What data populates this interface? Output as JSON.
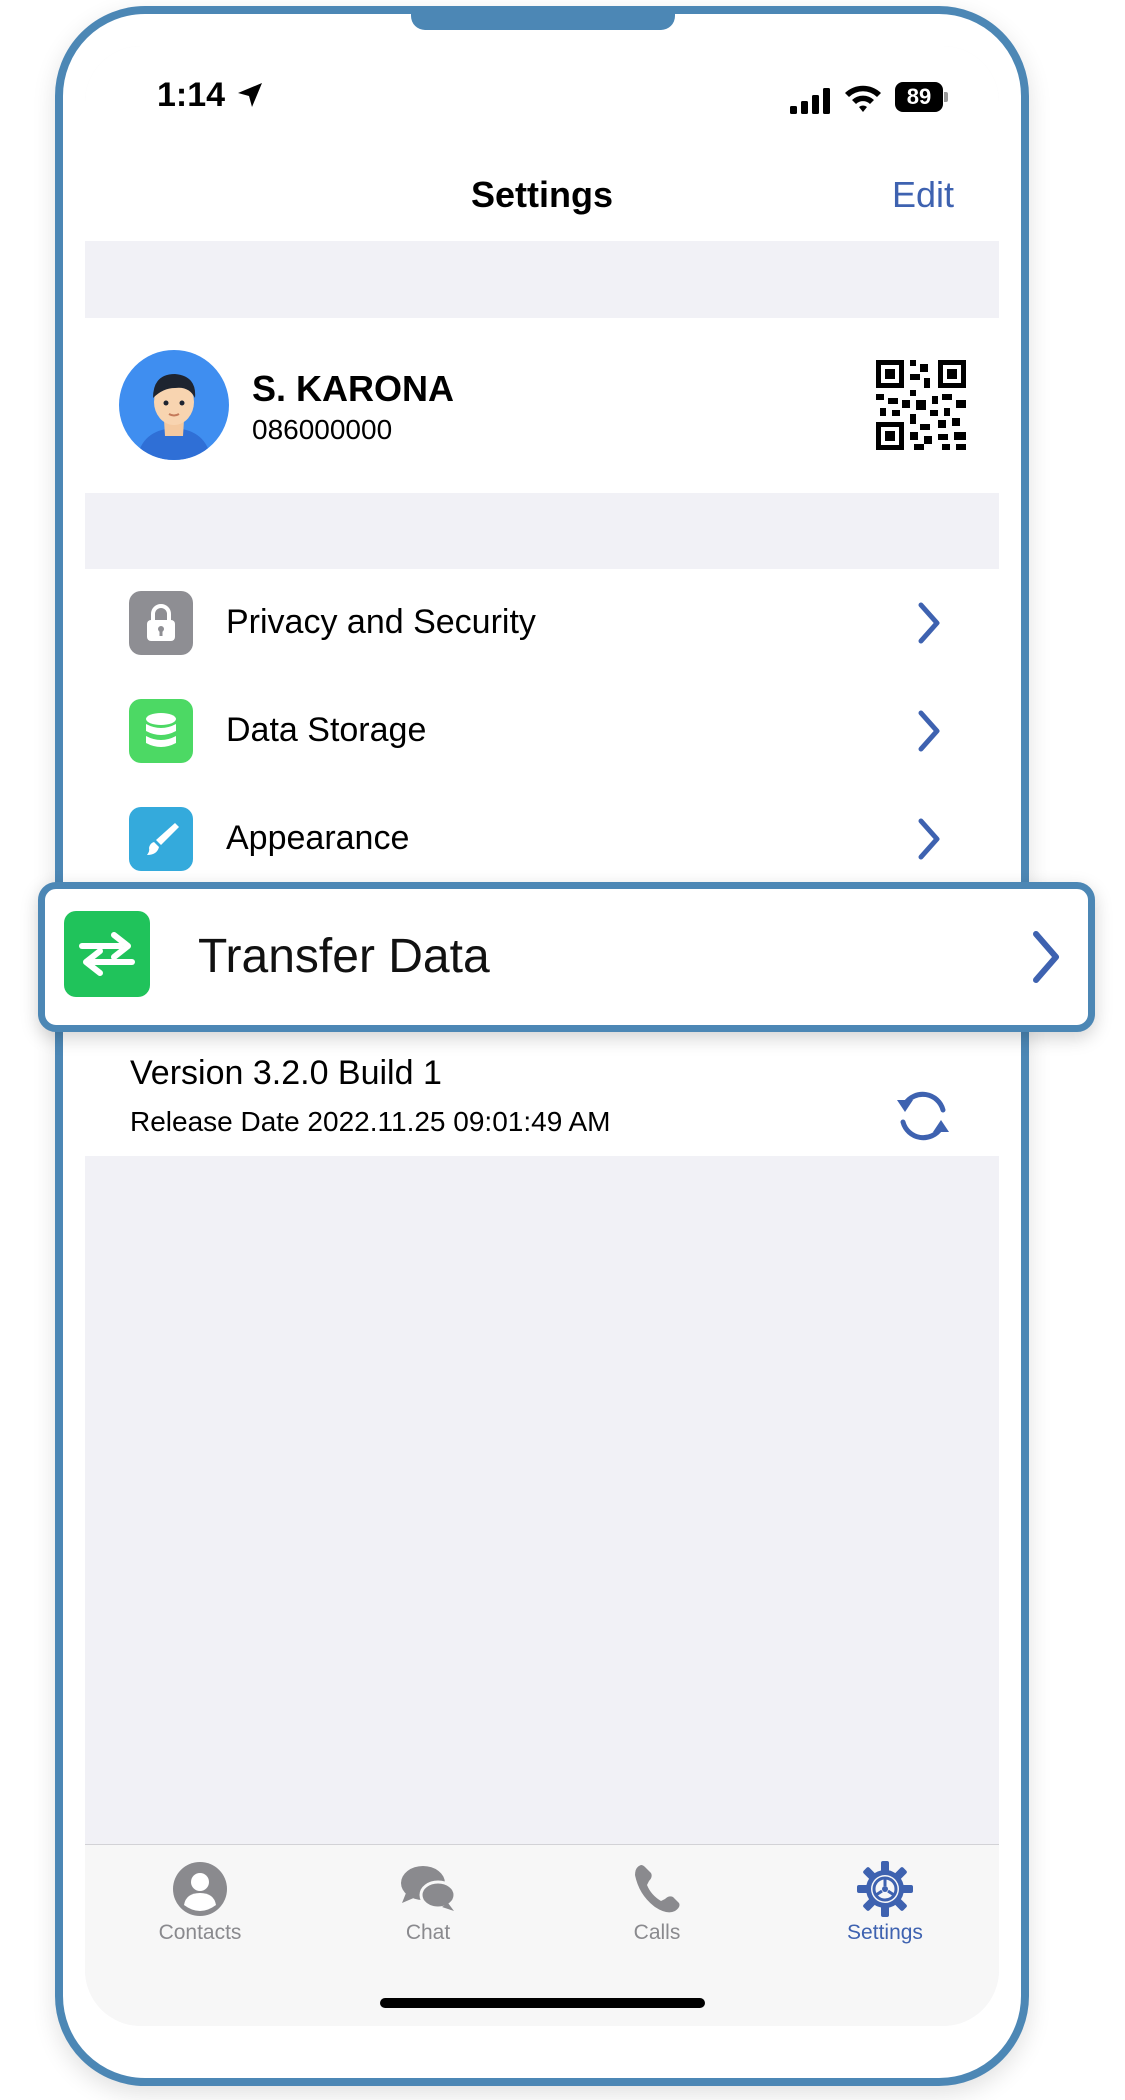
{
  "status_bar": {
    "time": "1:14",
    "battery": "89"
  },
  "nav": {
    "title": "Settings",
    "edit_label": "Edit"
  },
  "profile": {
    "name": "S. KARONA",
    "phone": "086000000"
  },
  "menu": {
    "items": [
      {
        "label": "Privacy and Security",
        "icon": "lock-icon",
        "color": "#8e8e93"
      },
      {
        "label": "Data Storage",
        "icon": "database-icon",
        "color": "#4cd964"
      },
      {
        "label": "Appearance",
        "icon": "brush-icon",
        "color": "#34aadc"
      }
    ]
  },
  "highlight": {
    "label": "Transfer Data",
    "icon": "transfer-arrows-icon",
    "color": "#20c35b"
  },
  "version": {
    "version": "Version 3.2.0 Build 1",
    "release": "Release Date 2022.11.25 09:01:49 AM"
  },
  "tabs": [
    {
      "label": "Contacts",
      "icon": "person-icon"
    },
    {
      "label": "Chat",
      "icon": "chat-bubbles-icon"
    },
    {
      "label": "Calls",
      "icon": "phone-icon"
    },
    {
      "label": "Settings",
      "icon": "gear-icon",
      "active": true
    }
  ],
  "colors": {
    "accent": "#3e62b0",
    "frame": "#4c87b5"
  }
}
